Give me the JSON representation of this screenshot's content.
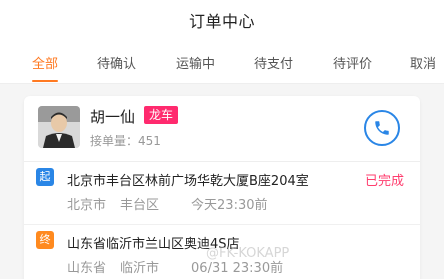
{
  "header": {
    "title": "订单中心"
  },
  "tabs": [
    {
      "label": "全部",
      "active": true
    },
    {
      "label": "待确认",
      "active": false
    },
    {
      "label": "运输中",
      "active": false
    },
    {
      "label": "待支付",
      "active": false
    },
    {
      "label": "待评价",
      "active": false
    },
    {
      "label": "取消",
      "active": false
    }
  ],
  "order": {
    "driver": {
      "name": "胡一仙",
      "car_type": "龙车",
      "order_count": "接单量：451"
    },
    "status": "已完成",
    "start": {
      "tag": "起",
      "address": "北京市丰台区林前广场华乾大厦B座204室",
      "city": "北京市",
      "district": "丰台区",
      "time": "今天23:30前"
    },
    "end": {
      "tag": "终",
      "address": "山东省临沂市兰山区奥迪4S店",
      "province": "山东省",
      "city": "临沂市",
      "time": "06/31 23:30前"
    }
  },
  "watermark": "@FK-KOKAPP",
  "colors": {
    "accent": "#ff7a22",
    "badge": "#ff2a6e",
    "phone": "#2a86e6",
    "status": "#ff3d6e"
  }
}
